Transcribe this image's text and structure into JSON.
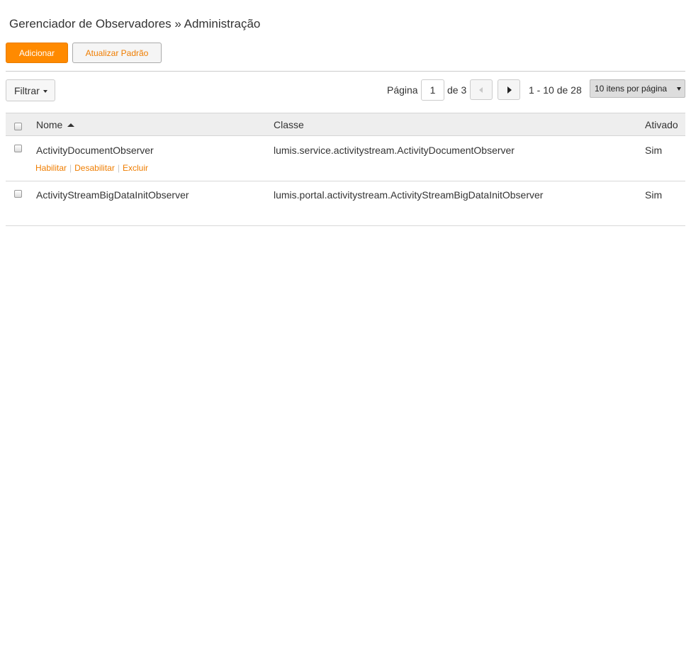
{
  "header": {
    "title": "Gerenciador de Observadores » Administração"
  },
  "toolbar": {
    "add_label": "Adicionar",
    "update_default_label": "Atualizar Padrão"
  },
  "filter": {
    "label": "Filtrar"
  },
  "pagination": {
    "page_label": "Página",
    "current_page": "1",
    "of_label": "de 3",
    "range_text": "1 - 10 de 28",
    "per_page_selected": "10 itens por página"
  },
  "table": {
    "columns": [
      "Nome",
      "Classe",
      "Ativado"
    ],
    "sort_column": "Nome",
    "sort_direction": "ascending",
    "rows": [
      {
        "name": "ActivityDocumentObserver",
        "class": "lumis.service.activitystream.ActivityDocumentObserver",
        "enabled": "Sim",
        "actions": [
          "Habilitar",
          "Desabilitar",
          "Excluir"
        ]
      },
      {
        "name": "ActivityStreamBigDataInitObserver",
        "class": "lumis.portal.activitystream.ActivityStreamBigDataInitObserver",
        "enabled": "Sim"
      }
    ]
  },
  "colors": {
    "accent": "#ff8a00",
    "link": "#ef7d00",
    "header_bg": "#eeeeee"
  },
  "icons": [
    "caret-down-icon",
    "prev-page-icon",
    "next-page-icon",
    "sort-ascending-icon",
    "select-caret-icon"
  ]
}
